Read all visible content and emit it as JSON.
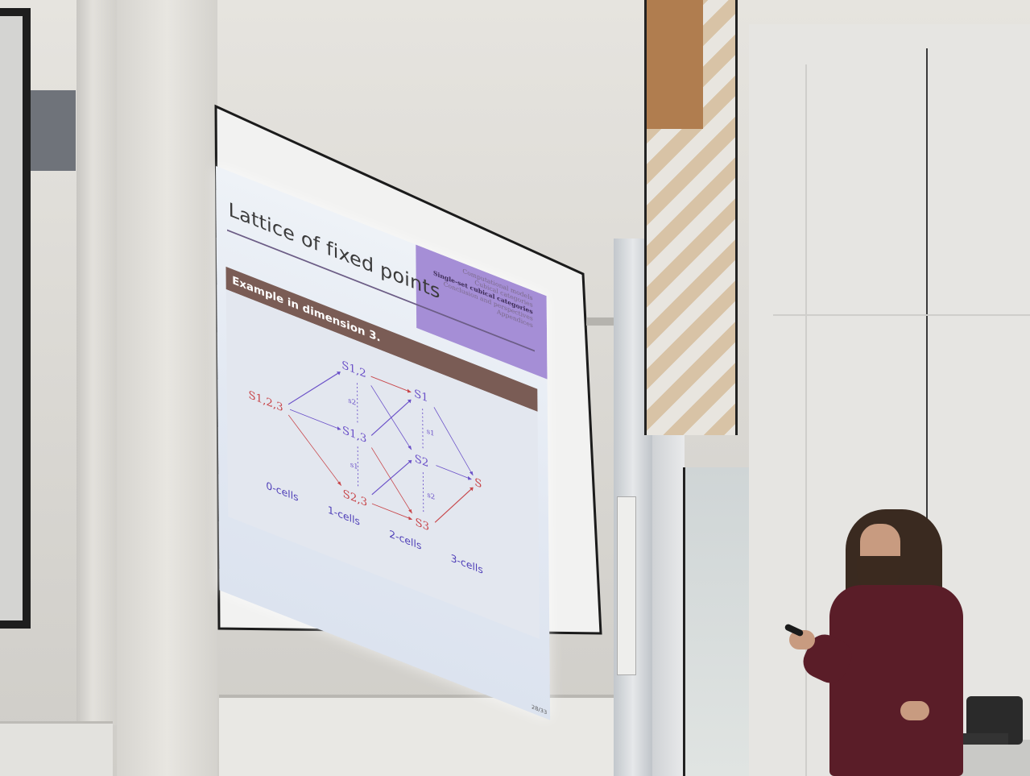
{
  "slide": {
    "nav": [
      "Computational models",
      "Cubical categories",
      "Single-set cubical categories",
      "Conclusion and perspectives",
      "Appendices"
    ],
    "nav_current_index": 2,
    "title": "Lattice of fixed points",
    "block_title": "Example in dimension 3.",
    "page_number": "28/33",
    "accent_color": "#a58ed6",
    "block_color": "#7a5c55",
    "nodes": {
      "s123": "S1,2,3",
      "s12": "S1,2",
      "s13": "S1,3",
      "s23": "S2,3",
      "s1": "S1",
      "s2": "S2",
      "s3": "S3",
      "s": "S"
    },
    "edge_labels": {
      "a": "s2",
      "b": "s1",
      "c": "s1",
      "d": "s2"
    },
    "captions": [
      "0-cells",
      "1-cells",
      "2-cells",
      "3-cells"
    ],
    "caption_color": "#4f3fb8",
    "node_color_red": "#c8464a",
    "node_color_purple": "#6a50c8"
  }
}
